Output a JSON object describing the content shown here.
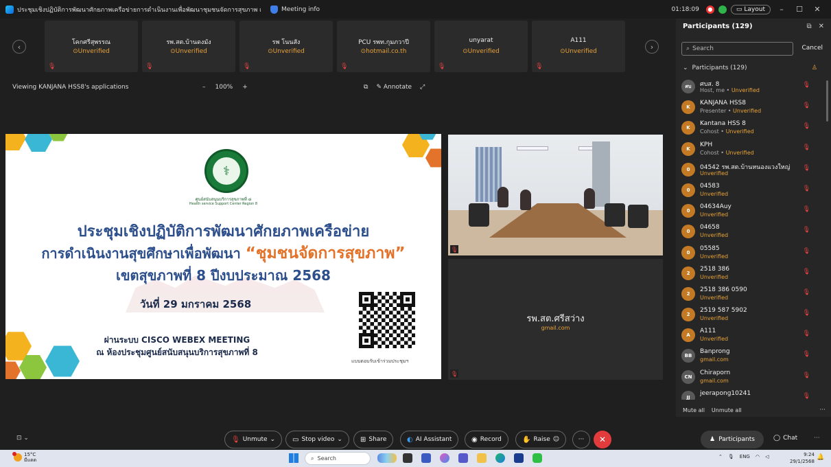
{
  "window": {
    "title": "ประชุมเชิงปฏิบัติการพัฒนาศักยภาพเครือข่ายการดำเนินงานเพื่อพัฒนาชุมชนจัดการสุขภาพ เขตสุขภาพที่ 8",
    "meeting_info": "Meeting info",
    "timer": "01:18:09",
    "layout_label": "Layout",
    "minimize": "–",
    "maximize": "☐",
    "close": "✕"
  },
  "strip": {
    "prev": "‹",
    "next": "›",
    "tiles": [
      {
        "name": "โคกศรีสุพรรณ",
        "status": "Unverified"
      },
      {
        "name": "รพ.สต.บ้านดงมัง",
        "status": "Unverified"
      },
      {
        "name": "รพ โนนสัง",
        "status": "Unverified"
      },
      {
        "name": "PCU รพท.กุมภวาปี",
        "status": "hotmail.co.th"
      },
      {
        "name": "unyarat",
        "status": "Unverified"
      },
      {
        "name": "A111",
        "status": "Unverified"
      }
    ]
  },
  "share_bar": {
    "viewing": "Viewing KANJANA HSS8's applications",
    "zoom_out": "–",
    "zoom": "100%",
    "zoom_in": "+",
    "annotate": "Annotate"
  },
  "slide": {
    "emblem_text": "ศูนย์สนับสนุนบริการสุขภาพที่ ๘",
    "emblem_sub": "Health service Support Center Region 8",
    "line1": "ประชุมเชิงปฏิบัติการพัฒนาศักยภาพเครือข่าย",
    "line2a": "การดำเนินงานสุขศึกษาเพื่อพัฒนา ",
    "line2b": "“ชุมชนจัดการสุขภาพ”",
    "line3": "เขตสุขภาพที่ 8 ปีงบประมาณ 2568",
    "date": "วันที่ 29 มกราคม 2568",
    "via1": "ผ่านระบบ CISCO WEBEX MEETING",
    "via2": "ณ ห้องประชุมศูนย์สนับสนุนบริการสุขภาพที่ 8",
    "qr_caption": "แบบตอบรับเข้าร่วมประชุมฯ"
  },
  "video2": {
    "name": "รพ.สต.ศรีสว่าง",
    "sub": "gmail.com"
  },
  "panel": {
    "title": "Participants (129)",
    "search_placeholder": "Search",
    "cancel": "Cancel",
    "group": "Participants (129)",
    "participants": [
      {
        "initials": "ศบ",
        "name": "ศบส. 8",
        "role": "Host, me",
        "status": "Unverified",
        "avatar": "gray"
      },
      {
        "initials": "K",
        "name": "KANJANA HSS8",
        "role": "Presenter",
        "status": "Unverified",
        "avatar": "orange"
      },
      {
        "initials": "K",
        "name": "Kantana HSS 8",
        "role": "Cohost",
        "status": "Unverified",
        "avatar": "orange"
      },
      {
        "initials": "K",
        "name": "KPH",
        "role": "Cohost",
        "status": "Unverified",
        "avatar": "orange"
      },
      {
        "initials": "0",
        "name": "04542 รพ.สต.บ้านหนองแวงใหญ่",
        "role": "",
        "status": "Unverified",
        "avatar": "orange"
      },
      {
        "initials": "0",
        "name": "04583",
        "role": "",
        "status": "Unverified",
        "avatar": "orange"
      },
      {
        "initials": "0",
        "name": "04634Auy",
        "role": "",
        "status": "Unverified",
        "avatar": "orange"
      },
      {
        "initials": "0",
        "name": "04658",
        "role": "",
        "status": "Unverified",
        "avatar": "orange"
      },
      {
        "initials": "0",
        "name": "05585",
        "role": "",
        "status": "Unverified",
        "avatar": "orange"
      },
      {
        "initials": "2",
        "name": "2518 386",
        "role": "",
        "status": "Unverified",
        "avatar": "orange"
      },
      {
        "initials": "2",
        "name": "2518 386 0590",
        "role": "",
        "status": "Unverified",
        "avatar": "orange"
      },
      {
        "initials": "2",
        "name": "2519 587 5902",
        "role": "",
        "status": "Unverified",
        "avatar": "orange"
      },
      {
        "initials": "A",
        "name": "A111",
        "role": "",
        "status": "Unverified",
        "avatar": "orange"
      },
      {
        "initials": "BB",
        "name": "Banprong",
        "role": "",
        "status": "gmail.com",
        "avatar": "gray"
      },
      {
        "initials": "CN",
        "name": "Chiraporn",
        "role": "",
        "status": "gmail.com",
        "avatar": "gray"
      },
      {
        "initials": "JJ",
        "name": "jeerapong10241",
        "role": "",
        "status": "",
        "avatar": "gray"
      }
    ],
    "mute_all": "Mute all",
    "unmute_all": "Unmute all",
    "more": "···"
  },
  "controls": {
    "cc": "⊡ ⌄",
    "unmute": "Unmute",
    "stop_video": "Stop video",
    "share": "Share",
    "ai": "AI Assistant",
    "record": "Record",
    "raise": "Raise",
    "more": "···",
    "end": "✕",
    "participants": "Participants",
    "chat": "Chat",
    "more_right": "···"
  },
  "taskbar": {
    "temp": "15°C",
    "weather_note": "มีแดด",
    "search": "Search",
    "lang": "ENG",
    "time": "9:24",
    "date": "29/1/2568"
  },
  "colors": {
    "accent_orange": "#e8a33a",
    "mic_red": "#e44444",
    "slide_blue": "#2d4f8c",
    "slide_orange": "#e3732a"
  }
}
